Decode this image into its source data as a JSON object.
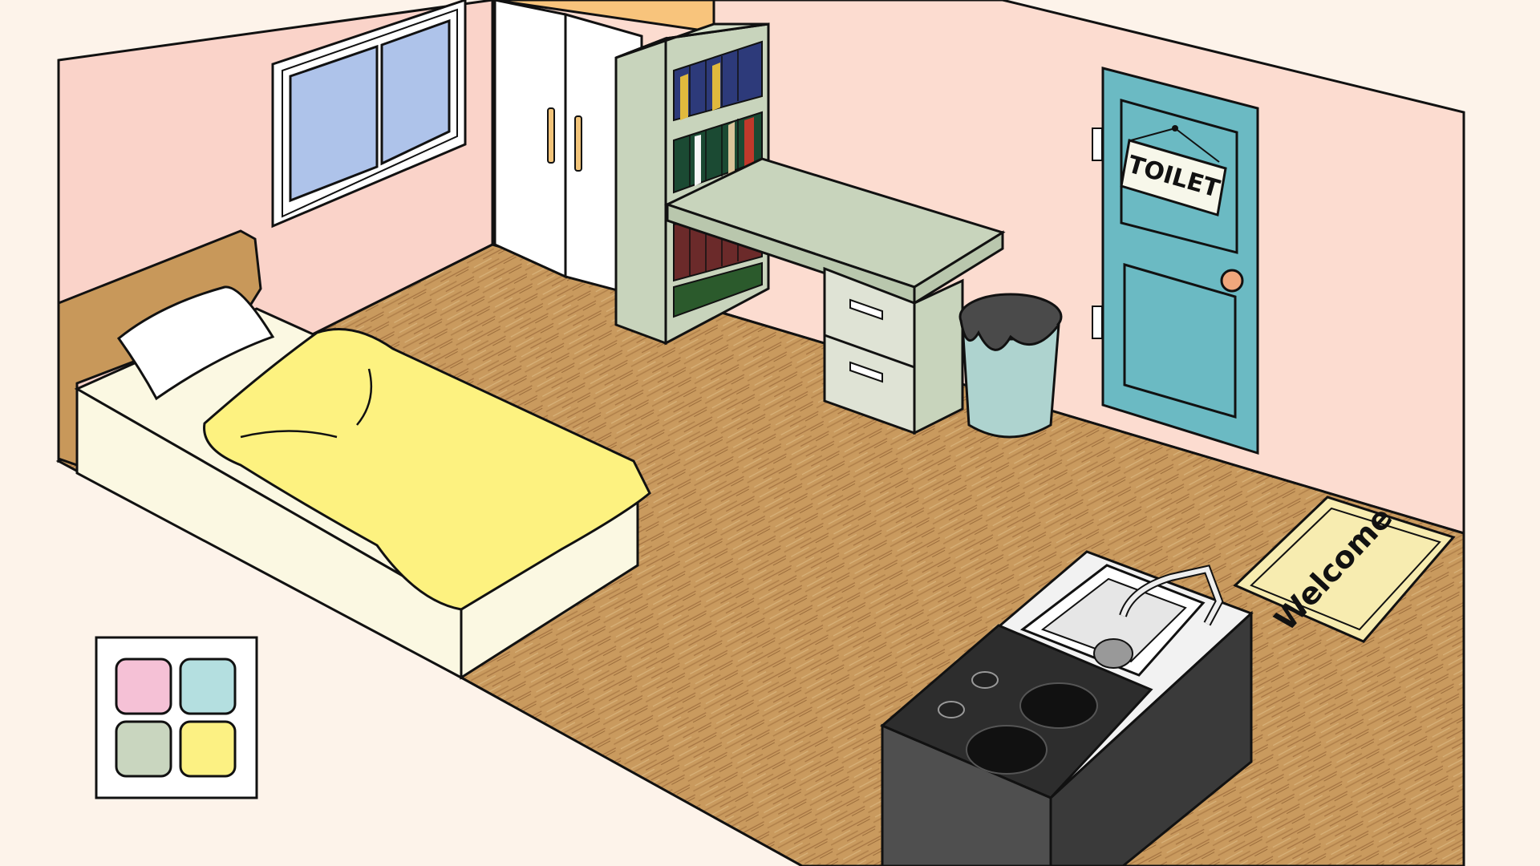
{
  "scene": {
    "door_sign": "TOILET",
    "doormat_text": "Welcome",
    "palette": {
      "swatches": [
        {
          "name": "pink",
          "color": "#f5c1d6"
        },
        {
          "name": "cyan",
          "color": "#b4dfe0"
        },
        {
          "name": "sage",
          "color": "#c9d6bf"
        },
        {
          "name": "yellow",
          "color": "#fcf183"
        }
      ]
    },
    "colors": {
      "background": "#fdf3ea",
      "wall": "#fcdcd0",
      "floor": "#c99a5e",
      "door": "#6bbac3",
      "blanket": "#fdf280",
      "furniture": "#c8d4bc",
      "stove": "#2d2d2d"
    },
    "icons": [
      "door-icon",
      "bed-icon",
      "window-icon",
      "wardrobe-icon",
      "bookshelf-icon",
      "desk-icon",
      "trash-bin-icon",
      "sink-icon",
      "stove-icon",
      "doormat-icon",
      "palette-icon"
    ]
  }
}
